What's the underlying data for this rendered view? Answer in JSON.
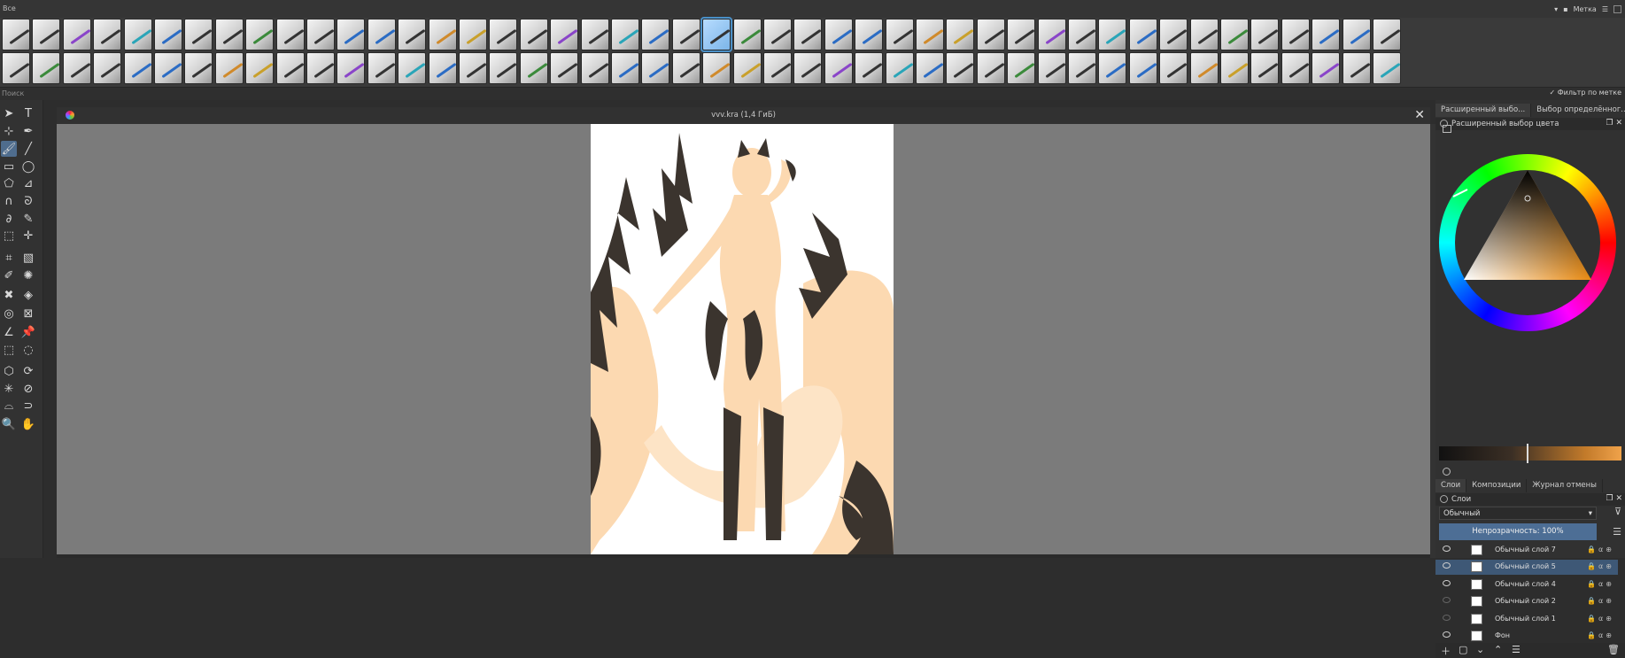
{
  "presets_bar": {
    "filter_label": "Все",
    "tag_label": "Метка",
    "search_placeholder": "Поиск",
    "tag_filter_label": "Фильтр по метке",
    "tag_filter_checked": true,
    "row1_count": 46,
    "row2_count": 46,
    "selected_index": 23
  },
  "document": {
    "title": "vvv.kra (1,4 ГиБ)",
    "close_glyph": "✕"
  },
  "toolbox": {
    "tools": [
      {
        "name": "select-shapes-tool",
        "glyph": "➤"
      },
      {
        "name": "text-tool",
        "glyph": "T"
      },
      {
        "name": "edit-shapes-tool",
        "glyph": "⊹"
      },
      {
        "name": "calligraphy-tool",
        "glyph": "✒"
      },
      {
        "name": "freehand-brush-tool",
        "glyph": "🖌",
        "active": true
      },
      {
        "name": "line-tool",
        "glyph": "╱"
      },
      {
        "name": "rectangle-tool",
        "glyph": "▭"
      },
      {
        "name": "ellipse-tool",
        "glyph": "◯"
      },
      {
        "name": "polygon-tool",
        "glyph": "⬠"
      },
      {
        "name": "polyline-tool",
        "glyph": "⊿"
      },
      {
        "name": "bezier-tool",
        "glyph": "∩"
      },
      {
        "name": "freehand-path-tool",
        "glyph": "ᘐ"
      },
      {
        "name": "dynamic-brush-tool",
        "glyph": "∂"
      },
      {
        "name": "multibrush-tool",
        "glyph": "✎"
      },
      {
        "name": "transform-tool",
        "glyph": "⬚"
      },
      {
        "name": "move-tool",
        "glyph": "✛"
      },
      {
        "name": "crop-tool",
        "glyph": "⌗"
      },
      {
        "name": "gradient-tool",
        "glyph": "▧"
      },
      {
        "name": "color-picker-tool",
        "glyph": "✐"
      },
      {
        "name": "smart-patch-tool",
        "glyph": "✺"
      },
      {
        "name": "colorize-mask-tool",
        "glyph": "✖"
      },
      {
        "name": "fill-tool",
        "glyph": "◈"
      },
      {
        "name": "enclose-fill-tool",
        "glyph": "◎"
      },
      {
        "name": "assistant-tool",
        "glyph": "⊠"
      },
      {
        "name": "measure-tool",
        "glyph": "∠"
      },
      {
        "name": "reference-tool",
        "glyph": "📌"
      },
      {
        "name": "rect-select-tool",
        "glyph": "⬚"
      },
      {
        "name": "ellipse-select-tool",
        "glyph": "◌"
      },
      {
        "name": "polygon-select-tool",
        "glyph": "⬡"
      },
      {
        "name": "freehand-select-tool",
        "glyph": "⟳"
      },
      {
        "name": "contiguous-select-tool",
        "glyph": "✳"
      },
      {
        "name": "similar-select-tool",
        "glyph": "⊘"
      },
      {
        "name": "bezier-select-tool",
        "glyph": "⌓"
      },
      {
        "name": "magnetic-select-tool",
        "glyph": "⊃"
      },
      {
        "name": "zoom-tool",
        "glyph": "🔍"
      },
      {
        "name": "pan-tool",
        "glyph": "✋"
      }
    ]
  },
  "dock": {
    "top_tabs": [
      "Расширенный выбо...",
      "Выбор определённог..."
    ],
    "color_panel_title": "Расширенный выбор цвета",
    "layers_tabs": [
      "Слои",
      "Композиции",
      "Журнал отмены"
    ],
    "layers_panel_title": "Слои",
    "blend_mode": "Обычный",
    "opacity_label": "Непрозрачность:  100%",
    "layers": [
      {
        "name": "Обычный слой 7",
        "visible": true,
        "selected": false
      },
      {
        "name": "Обычный слой 5",
        "visible": true,
        "selected": true
      },
      {
        "name": "Обычный слой 4",
        "visible": true,
        "selected": false
      },
      {
        "name": "Обычный слой 2",
        "visible": false,
        "selected": false
      },
      {
        "name": "Обычный слой 1",
        "visible": false,
        "selected": false
      },
      {
        "name": "Фон",
        "visible": true,
        "selected": false
      }
    ]
  },
  "colors": {
    "accent": "#4f6d8e",
    "selection": "#3e5876",
    "canvas": "#7b7b7b",
    "skin": "#fcd9b1",
    "fur_dark": "#3b342e"
  }
}
